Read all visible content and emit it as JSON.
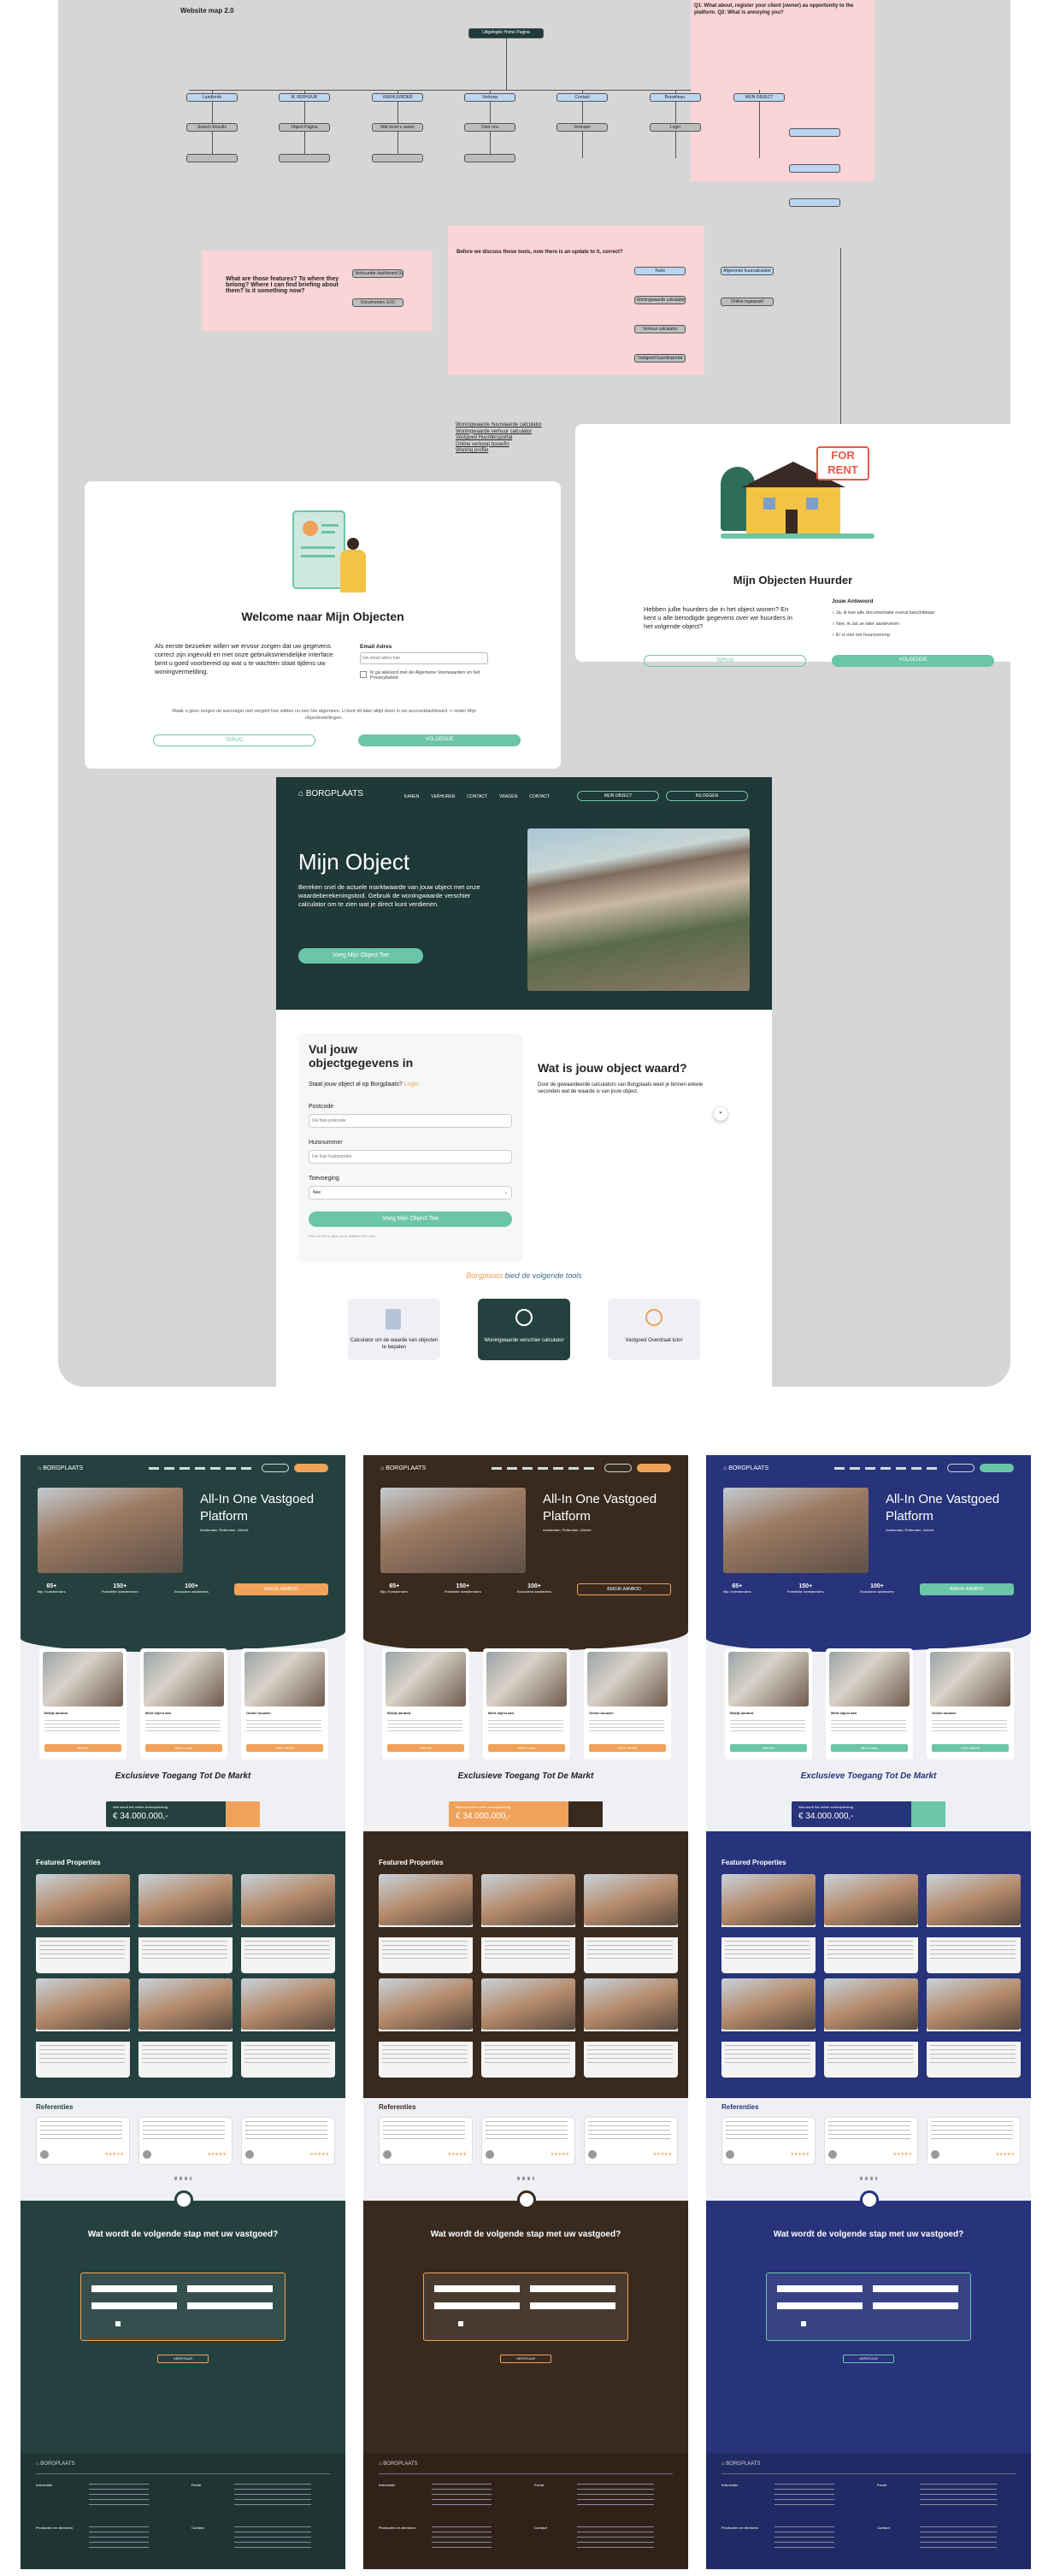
{
  "sitemap": {
    "title": "Website map 2.0",
    "root": "Uitgelogde Home Pagina",
    "nodes": [
      "Landlords",
      "IK VERHUUR",
      "VERHUURDER",
      "Verkoop",
      "Contact",
      "Bouwfinan.",
      "MIJN OBJECT"
    ],
    "subs": [
      "Search Results",
      "Object Pagina",
      "Wat moet u weten",
      "Over ons",
      "Verkoper",
      "Login"
    ],
    "notes_top": "Q1: What about, register your client (owner) as opportunity to the platform. Q2: What is annoying you?",
    "note_features": "What are those features? To where they belong? Where I can find briefing about them? Is it something now?",
    "note_tools": "Before we discuss those tools, now there is an update to it, correct?",
    "tools_list": [
      "Woningwaarde huurwaarde calculator",
      "Woningwaarde verhuur calculator",
      "Vastgoed Huurdersportal",
      "Online verkoop bouwfin",
      "Woning profiel"
    ]
  },
  "welcome": {
    "title": "Welcome naar Mijn Objecten",
    "body": "Als eerste bezoeker willen we ervoor zorgen dat uw gegevens correct zijn ingevuld en met onze gebruiksvriendelijke interface bent u goed voorbereid op wat u te wachten staat tijdens uw woningvermelding.",
    "email_label": "Email Adres",
    "email_placeholder": "Uw email adres hier",
    "terms": "Ik ga akkoord met de Algemene Voorwaarden en het Privacybeleid",
    "footnote": "Waak u geen zorgen de aanvrager niet vergeld hoe wilden nu een Uw algemeen. U kunt dit later altijd doen in uw accountdashboard -> onder Mijn objectinstellingen.",
    "btn_back": "TERUG",
    "btn_next": "VOLGENDE"
  },
  "huurder": {
    "sign": "FOR RENT",
    "title": "Mijn Objecten Huurder",
    "question": "Hebben jullie huurders die in het object wonen? En kent u alle benodigde gegevens over we huurders in het volgende object?",
    "ans_label": "Jouw Antwoord",
    "answers": [
      "Ja, ik ken alle documentatie overal beschikbaar",
      "Nee, ik zal ze later aanleveren",
      "Er is niet om huurovereng"
    ],
    "btn_back": "TERUG",
    "btn_next": "VOLGENDE"
  },
  "mijnobject": {
    "logo": "BORGPLAATS",
    "nav": [
      "KANEN",
      "VERHUREN",
      "CONTACT",
      "VRAGEN",
      "CONTACT"
    ],
    "nav_btn": "MIJN OBJECT",
    "nav_btn2": "INLOGGEN",
    "hero_title": "Mijn Object",
    "hero_text": "Bereken snel de actuele marktwaarde van jouw object met onze waardeberekeningstool. Gebruik de woningwaarde verschier calculator om te zien wat je direct kunt verdienen.",
    "hero_btn": "Voeg Mijn Object Toe",
    "form_title": "Vul jouw objectgegevens in",
    "form_sub": "Staat jouw object al op Borgplaats?",
    "form_login": "Login",
    "postcode_label": "Postcode",
    "postcode_ph": "Uw huis postcode",
    "huisnr_label": "Huisnummer",
    "huisnr_ph": "Uw huis huisnummer",
    "toev_label": "Toevoeging",
    "toev_val": "Nee",
    "form_btn": "Voeg Mijn Object Toe",
    "form_foot": "Door verder te gaan ga je akkoord met onze",
    "value_title": "Wat is jouw object waard?",
    "value_text": "Door de gewaardeerde calculators van Borgplaats weet je binnen enkele seconden wat de waarde is van jouw object.",
    "tools_heading_brand": "Borgplaats",
    "tools_heading": "bied de volgende tools",
    "tools": [
      "Calculator om de waarde van objecten te bepalen",
      "Woningwaarde verschier calculator",
      "Vastgoed Overdraat tutor"
    ]
  },
  "landing": {
    "logo": "BORGPLAATS",
    "hero_title": "All-In One Vastgoed Platform",
    "hero_sub": "Amsterdam, Rotterdam, Utrecht",
    "stats": [
      {
        "n": "65+",
        "l": "Bijv. Investeerders"
      },
      {
        "n": "150+",
        "l": "Potentiële investeerders"
      },
      {
        "n": "100+",
        "l": "Exclusieve aanbieders"
      }
    ],
    "hero_btn": "BEKIJK AANBOD",
    "cards": [
      {
        "t": "Bekijk aanbod",
        "b": "BEKIJK"
      },
      {
        "t": "Meld object aan",
        "b": "MELD AAN"
      },
      {
        "t": "Online bouwen",
        "b": "LEES MEER"
      }
    ],
    "excl_title": "Exclusieve Toegang Tot De Markt",
    "price_label": "Wat wordt het online verkoopbedrag",
    "price": "€ 34.000.000,-",
    "featured": "Featured Properties",
    "refs": "Referenties",
    "cta_title": "Wat wordt de volgende stap met uw vastgoed?",
    "cta_btn": "VERSTUUR",
    "footer_labels": [
      "Informatie",
      "Producten en diensten",
      "Portal",
      "Contact"
    ]
  },
  "colors": {
    "themes": [
      "#24413f",
      "#3a2a1e",
      "#27337a"
    ],
    "accents": [
      "#f0a25a",
      "#f0a25a",
      "#6bc5a8"
    ],
    "mint": "#6bc5a8",
    "pink": "#fad4d6"
  }
}
